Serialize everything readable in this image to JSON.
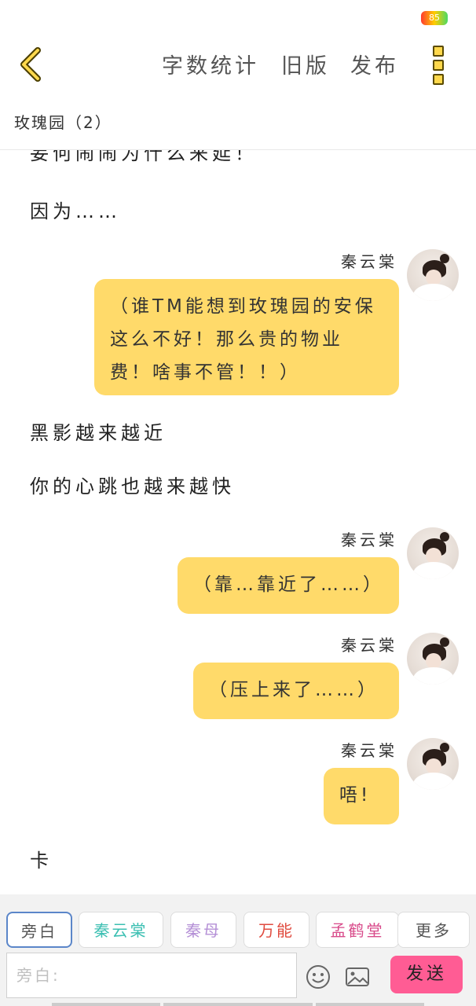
{
  "status": {
    "battery": "85"
  },
  "topbar": {
    "word_count": "字数统计",
    "old_version": "旧版",
    "publish": "发布"
  },
  "chat": {
    "title": "玫瑰园（2）"
  },
  "messages": {
    "partial_line": "妄何闹闹为什么来延！",
    "narration1": "因为……",
    "speaker1": "秦云棠",
    "bubble1": "（谁TM能想到玫瑰园的安保这么不好！那么贵的物业费！啥事不管！！）",
    "narration2": "黑影越来越近",
    "narration3": "你的心跳也越来越快",
    "speaker2": "秦云棠",
    "bubble2": "（靠…靠近了……）",
    "speaker3": "秦云棠",
    "bubble3": "（压上来了……）",
    "speaker4": "秦云棠",
    "bubble4": "唔!",
    "narration4": "卡"
  },
  "roles": {
    "narrator": "旁白",
    "qin_yuntang": "秦云棠",
    "qin_mu": "秦母",
    "wanneng": "万能",
    "meng_hetang": "孟鹤堂",
    "more": "更多"
  },
  "role_colors": {
    "qin_yuntang": "#3bbfb2",
    "qin_mu": "#b48fd6",
    "wanneng": "#e04b3f",
    "meng_hetang": "#d84a8a"
  },
  "composer": {
    "placeholder": "旁白:",
    "send": "发送",
    "emoji_icon": "smiley-icon",
    "image_icon": "image-icon"
  }
}
